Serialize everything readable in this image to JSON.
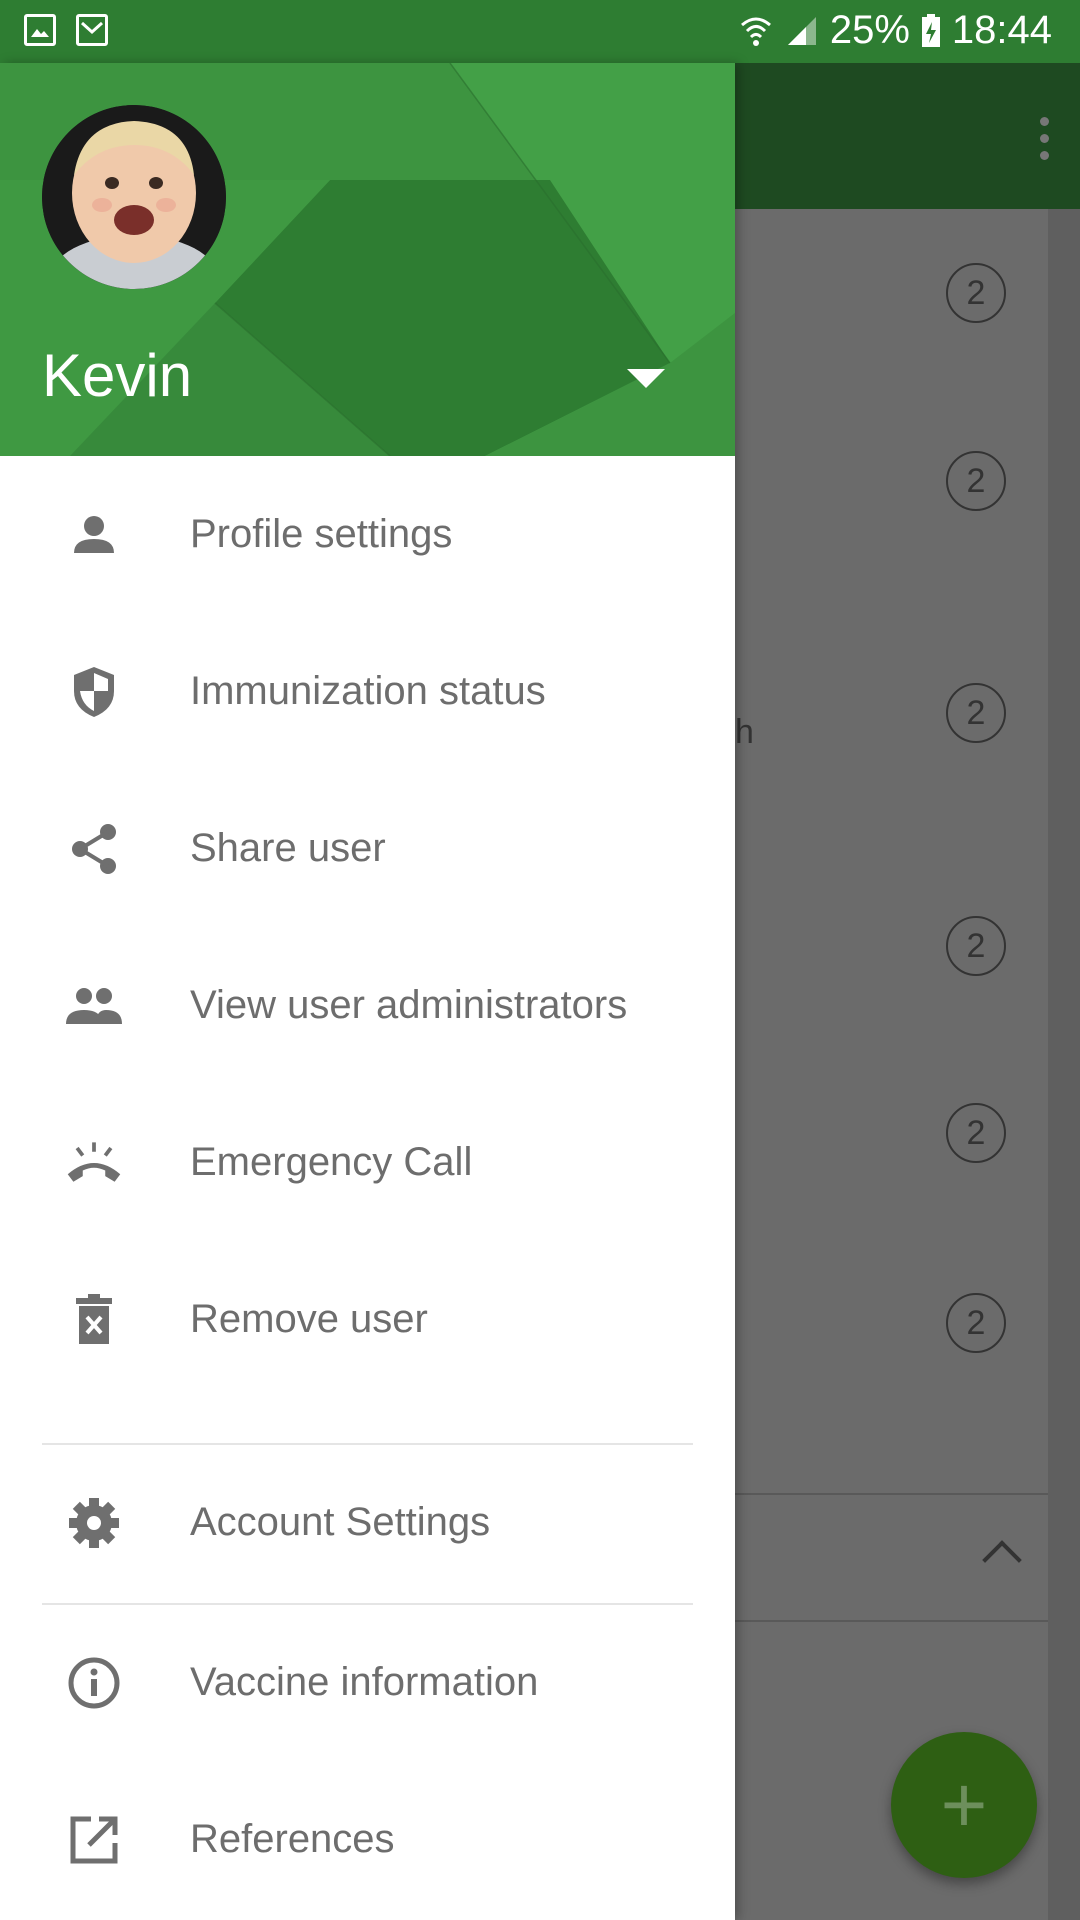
{
  "status_bar": {
    "battery": "25%",
    "time": "18:44"
  },
  "background": {
    "counts": [
      "2",
      "2",
      "2",
      "2",
      "2",
      "2"
    ],
    "peek_text": "h",
    "fab_icon": "+"
  },
  "drawer": {
    "account_name": "Kevin",
    "items": [
      {
        "label": "Profile settings",
        "icon": "person-icon"
      },
      {
        "label": "Immunization status",
        "icon": "shield-icon"
      },
      {
        "label": "Share user",
        "icon": "share-icon"
      },
      {
        "label": "View user administrators",
        "icon": "people-icon"
      },
      {
        "label": "Emergency Call",
        "icon": "ring-phone-icon"
      },
      {
        "label": "Remove user",
        "icon": "delete-icon"
      },
      {
        "label": "Account Settings",
        "icon": "gear-icon"
      },
      {
        "label": "Vaccine information",
        "icon": "info-icon"
      },
      {
        "label": "References",
        "icon": "open-in-new-icon"
      }
    ]
  },
  "colors": {
    "status_bar": "#2e7d32",
    "header_green": "#43a047",
    "toolbar_dimmed": "#1e4a21",
    "fab": "#2e5f13",
    "menu_text": "#6d6d6d",
    "menu_icon": "#6f6f6f"
  }
}
